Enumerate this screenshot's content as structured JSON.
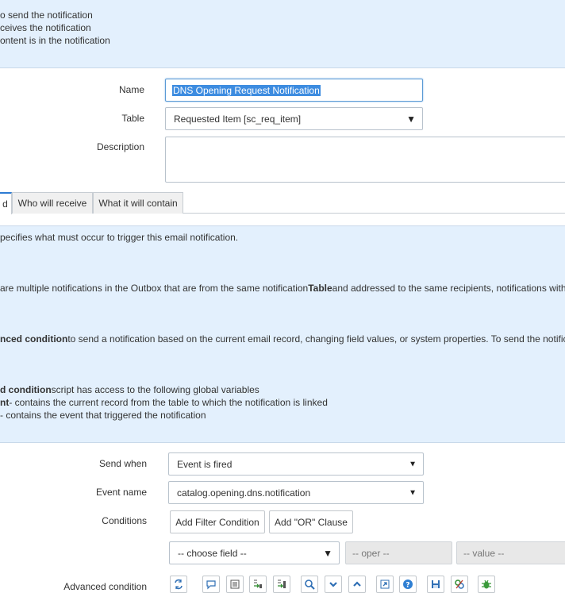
{
  "top_info": {
    "line1": "o send the notification",
    "line2": "ceives the notification",
    "line3": "ontent is in the notification"
  },
  "form": {
    "name_label": "Name",
    "name_value": "DNS Opening Request Notification",
    "table_label": "Table",
    "table_value": "Requested Item [sc_req_item]",
    "description_label": "Description",
    "description_value": ""
  },
  "tabs": [
    {
      "label": "d"
    },
    {
      "label": "Who will receive"
    },
    {
      "label": "What it will contain"
    }
  ],
  "when_info": {
    "line1": "pecifies what must occur to trigger this email notification.",
    "line2_pre": "are multiple notifications in the Outbox that are from the same notification",
    "line2_bold": "Table",
    "line2_post": "and addressed to the same recipients, notifications with the",
    "line3_bold": "nced condition",
    "line3_post": "to send a notification based on the current email record, changing field values, or system properties. To send the notificatio",
    "line4_bold": "d condition",
    "line4_post": "script has access to the following global variables",
    "line5_bold": "nt",
    "line5_post": "- contains the current record from the table to which the notification is linked",
    "line6": "- contains the event that triggered the notification"
  },
  "send": {
    "send_when_label": "Send when",
    "send_when_value": "Event is fired",
    "event_name_label": "Event name",
    "event_name_value": "catalog.opening.dns.notification",
    "conditions_label": "Conditions",
    "add_filter_label": "Add Filter Condition",
    "add_or_label": "Add \"OR\" Clause",
    "choose_field": "-- choose field --",
    "oper": "-- oper --",
    "value": "-- value --",
    "advanced_label": "Advanced condition"
  },
  "toolbar_icons": [
    "format-icon",
    "comment-icon",
    "document-icon",
    "replace-icon",
    "replace-all-icon",
    "search-icon",
    "collapse-icon",
    "expand-icon",
    "fullscreen-icon",
    "help-icon",
    "save-icon",
    "script-debug-icon",
    "bug-icon"
  ]
}
